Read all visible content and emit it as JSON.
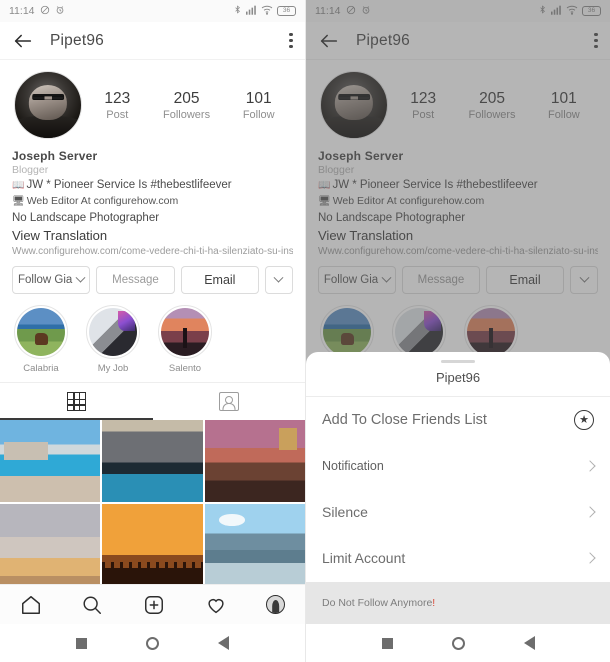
{
  "status_bar": {
    "time": "11:14",
    "icons": [
      "silent-icon",
      "alarm-icon",
      "bluetooth-icon",
      "signal-icon",
      "wifi-icon"
    ],
    "battery_level": "36"
  },
  "app_header": {
    "title": "Pipet96",
    "back_icon": "back-arrow-icon",
    "menu_icon": "kebab-menu-icon"
  },
  "profile": {
    "stats": [
      {
        "value": "123",
        "label": "Post"
      },
      {
        "value": "205",
        "label": "Followers"
      },
      {
        "value": "101",
        "label": "Follow"
      }
    ],
    "name": "Joseph Server",
    "category": "Blogger",
    "bio_line_1": "JW * Pioneer Service Is #thebestlifeever",
    "bio_line_1_emoji": "📖",
    "bio_line_2": "Web Editor At configurehow.com",
    "bio_line_2_emoji": "🖥",
    "bio_line_3": "No Landscape Photographer",
    "view_translation": "View Translation",
    "url": "Www.configurehow.com/come-vedere-chi-ti-ha-silenziato-su-ins..."
  },
  "actions": {
    "follow_label": "Follow Gia",
    "message_label": "Message",
    "email_label": "Email",
    "more_icon": "chevron-down-icon"
  },
  "highlights": [
    {
      "label": "Calabria"
    },
    {
      "label": "My Job"
    },
    {
      "label": "Salento"
    }
  ],
  "tabs": [
    {
      "name": "grid-tab",
      "icon": "grid-icon",
      "active": true
    },
    {
      "name": "tagged-tab",
      "icon": "tagged-person-icon",
      "active": false
    }
  ],
  "photo_grid": {
    "cells": [
      {
        "alt": "coastal-town-beach"
      },
      {
        "alt": "sea-cloudy-sunset"
      },
      {
        "alt": "cliff-tower-pink-sky"
      },
      {
        "alt": "pale-cloudy-horizon"
      },
      {
        "alt": "orange-sunset-silhouettes"
      },
      {
        "alt": "blue-lake-mountains"
      }
    ]
  },
  "bottom_nav": [
    {
      "name": "home-tab",
      "icon": "home-icon"
    },
    {
      "name": "search-tab",
      "icon": "search-icon"
    },
    {
      "name": "add-post-tab",
      "icon": "plus-square-icon"
    },
    {
      "name": "activity-tab",
      "icon": "heart-icon"
    },
    {
      "name": "profile-tab",
      "icon": "profile-avatar-icon"
    }
  ],
  "android_nav": [
    {
      "name": "recents-button",
      "icon": "square-icon"
    },
    {
      "name": "home-button",
      "icon": "circle-icon"
    },
    {
      "name": "back-button",
      "icon": "triangle-icon"
    }
  ],
  "sheet": {
    "title": "Pipet96",
    "rows": [
      {
        "label": "Add To Close Friends List",
        "trailing": "star-circle-icon"
      },
      {
        "label": "Notification",
        "trailing": "chevron-right-icon"
      },
      {
        "label": "Silence",
        "trailing": "chevron-right-icon"
      },
      {
        "label": "Limit Account",
        "trailing": "chevron-right-icon"
      }
    ],
    "footer_label": "Do Not Follow Anymore",
    "footer_accent": "!"
  },
  "colors": {
    "accent_danger": "#d94b3a",
    "text_primary": "#3d3d3d",
    "text_muted": "#8f8f8f",
    "sheet_footer_bg": "#e6e6e6"
  }
}
